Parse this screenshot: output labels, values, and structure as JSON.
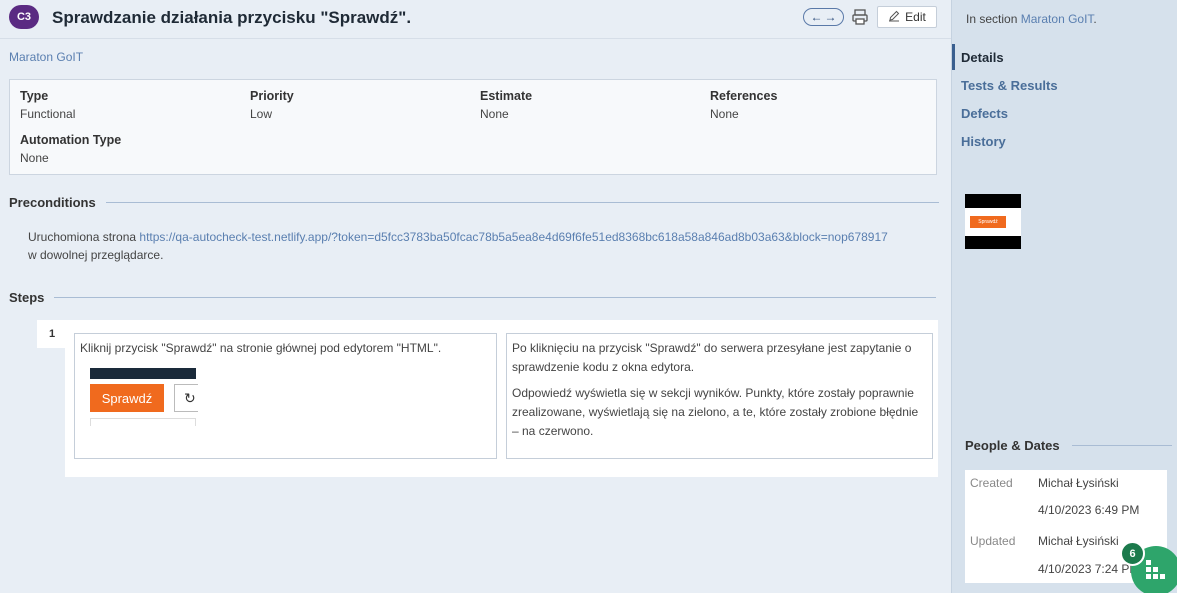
{
  "header": {
    "badge": "C3",
    "title": "Sprawdzanie działania przycisku \"Sprawdź\".",
    "edit_label": "Edit"
  },
  "section_link": "Maraton GoIT",
  "properties": [
    {
      "key": "Type",
      "value": "Functional"
    },
    {
      "key": "Priority",
      "value": "Low"
    },
    {
      "key": "Estimate",
      "value": "None"
    },
    {
      "key": "References",
      "value": "None"
    },
    {
      "key": "Automation Type",
      "value": "None"
    }
  ],
  "preconditions": {
    "heading": "Preconditions",
    "prefix": "Uruchomiona strona",
    "url": "https://qa-autocheck-test.netlify.app/?token=d5fcc3783ba50fcac78b5a5ea8e4d69f6fe51ed8368bc618a58a846ad8b03a63&block=nop678917",
    "suffix": "w dowolnej przeglądarce."
  },
  "steps": {
    "heading": "Steps",
    "items": [
      {
        "number": "1",
        "action": "Kliknij przycisk \"Sprawdź\" na stronie głównej pod edytorem \"HTML\".",
        "button_text": "Sprawdź",
        "expected_1": "Po kliknięciu na przycisk \"Sprawdź\" do serwera przesyłane jest zapytanie o sprawdzenie kodu z okna edytora.",
        "expected_2": "Odpowiedź wyświetla się w sekcji wyników. Punkty, które zostały poprawnie zrealizowane, wyświetlają się na zielono, a te, które zostały zrobione błędnie – na czerwono."
      }
    ]
  },
  "sidebar": {
    "in_section_prefix": "In section",
    "in_section_link": "Maraton GoIT",
    "nav": [
      "Details",
      "Tests & Results",
      "Defects",
      "History"
    ],
    "thumb_button": "Sprawdź",
    "people_heading": "People & Dates",
    "created_label": "Created",
    "created_by": "Michał Łysiński",
    "created_at": "4/10/2023 6:49 PM",
    "updated_label": "Updated",
    "updated_by": "Michał Łysiński",
    "updated_at": "4/10/2023 7:24 PM"
  },
  "fab": {
    "count": "6"
  },
  "colors": {
    "badge": "#5a2a82",
    "accent_orange": "#f06a1e",
    "fab_green": "#2ea56b",
    "link": "#5a7fb0"
  }
}
